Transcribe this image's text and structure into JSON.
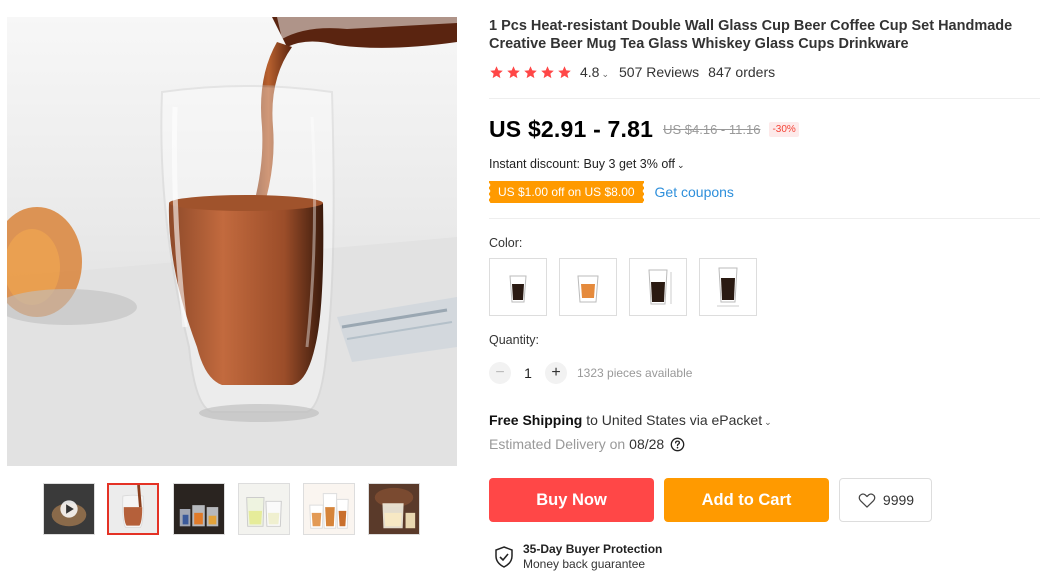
{
  "product": {
    "title": "1 Pcs Heat-resistant Double Wall Glass Cup Beer Coffee Cup Set Handmade Creative Beer Mug Tea Glass Whiskey Glass Cups Drinkware",
    "rating": "4.8",
    "rating_stars": 5,
    "reviews": "507 Reviews",
    "orders": "847 orders"
  },
  "pricing": {
    "price": "US $2.91 - 7.81",
    "original_price": "US $4.16 - 11.16",
    "discount_badge": "-30%",
    "instant_discount": "Instant discount: Buy 3 get 3% off",
    "coupon": "US $1.00 off on US $8.00",
    "get_coupons": "Get coupons"
  },
  "options": {
    "color_label": "Color:",
    "color_options": 4,
    "quantity_label": "Quantity:",
    "quantity_value": "1",
    "available": "1323 pieces available"
  },
  "shipping": {
    "free_shipping": "Free Shipping",
    "destination": "to United States via ePacket",
    "delivery_label": "Estimated Delivery on",
    "delivery_date": "08/28"
  },
  "actions": {
    "buy_now": "Buy Now",
    "add_to_cart": "Add to Cart",
    "wishlist_count": "9999"
  },
  "protection": {
    "title": "35-Day Buyer Protection",
    "subtitle": "Money back guarantee"
  },
  "colors": {
    "star": "#ff4747",
    "buy_button": "#ff4747",
    "cart_button": "#ff9a00",
    "coupon_bg": "#ff9a00",
    "link": "#2e8fdb"
  },
  "gallery": {
    "thumbnail_count": 6,
    "active_thumbnail": 2
  }
}
